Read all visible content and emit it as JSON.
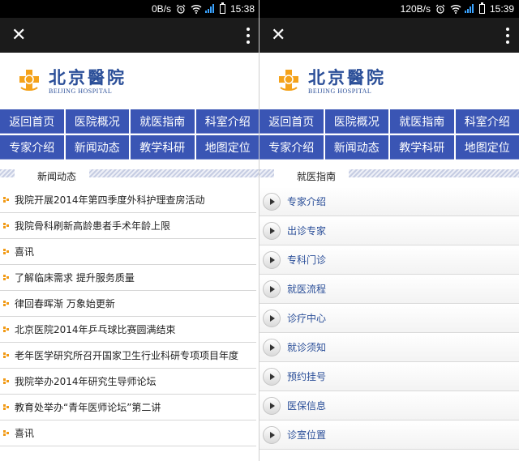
{
  "left": {
    "status": {
      "speed": "0B/s",
      "time": "15:38"
    },
    "section_title": "新闻动态",
    "news": [
      "我院开展2014年第四季度外科护理查房活动",
      "我院骨科刷新高龄患者手术年龄上限",
      "喜讯",
      "了解临床需求 提升服务质量",
      "律回春晖渐 万象始更新",
      "北京医院2014年乒乓球比赛圆满结束",
      "老年医学研究所召开国家卫生行业科研专项项目年度",
      "我院举办2014年研究生导师论坛",
      "教育处举办“青年医师论坛”第二讲",
      "喜讯"
    ]
  },
  "right": {
    "status": {
      "speed": "120B/s",
      "time": "15:39"
    },
    "section_title": "就医指南",
    "guide": [
      "专家介绍",
      "出诊专家",
      "专科门诊",
      "就医流程",
      "诊疗中心",
      "就诊须知",
      "预约挂号",
      "医保信息",
      "诊室位置"
    ]
  },
  "logo": {
    "cn": "北京醫院",
    "en": "BEIJING HOSPITAL"
  },
  "nav": [
    "返回首页",
    "医院概况",
    "就医指南",
    "科室介绍",
    "专家介绍",
    "新闻动态",
    "教学科研",
    "地图定位"
  ],
  "icons": {
    "close": "close-icon",
    "menu": "more-vertical-icon",
    "alarm": "alarm-icon",
    "wifi": "wifi-icon",
    "signal": "signal-icon",
    "battery": "battery-icon"
  },
  "colors": {
    "nav": "#3a55b4",
    "brand": "#2a4e98",
    "bullet": "#f19a16"
  }
}
